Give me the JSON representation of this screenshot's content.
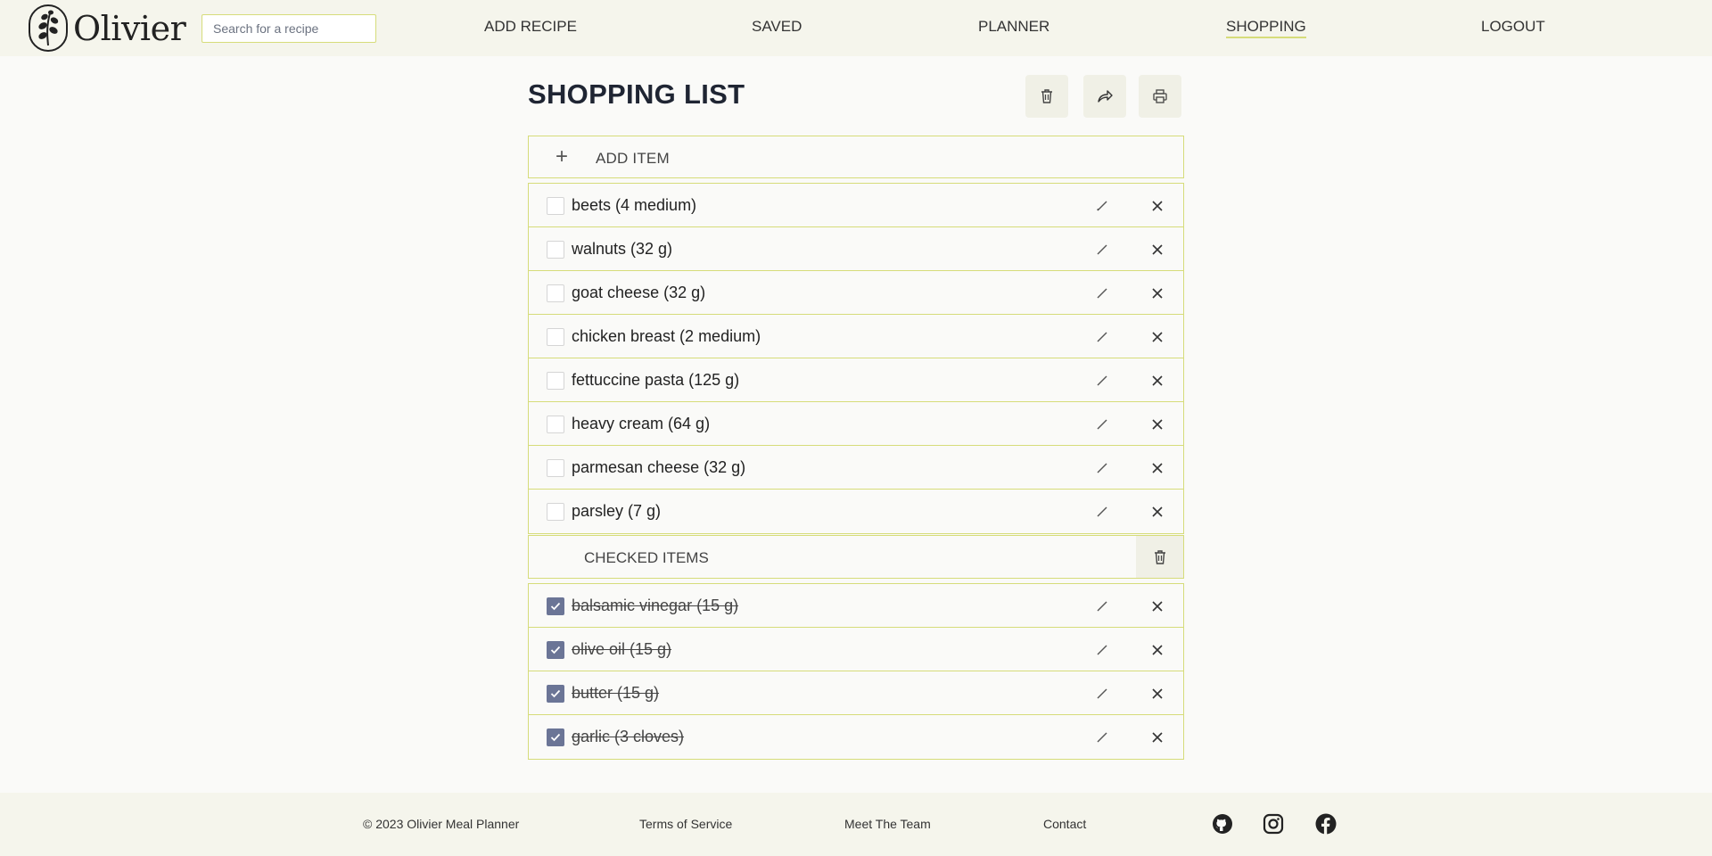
{
  "header": {
    "logo_text": "Olivier",
    "search_placeholder": "Search for a recipe",
    "nav": [
      {
        "label": "ADD RECIPE"
      },
      {
        "label": "SAVED"
      },
      {
        "label": "PLANNER"
      },
      {
        "label": "SHOPPING",
        "active": true
      },
      {
        "label": "LOGOUT"
      }
    ]
  },
  "page": {
    "title": "SHOPPING LIST",
    "toolbar": {
      "icons": [
        "trash-icon",
        "share-icon",
        "print-icon"
      ]
    },
    "add_item_label": "ADD ITEM",
    "items": [
      {
        "text": "beets (4 medium)",
        "checked": false
      },
      {
        "text": "walnuts (32 g)",
        "checked": false
      },
      {
        "text": "goat cheese (32 g)",
        "checked": false
      },
      {
        "text": "chicken breast (2 medium)",
        "checked": false
      },
      {
        "text": "fettuccine pasta (125 g)",
        "checked": false
      },
      {
        "text": "heavy cream (64 g)",
        "checked": false
      },
      {
        "text": "parmesan cheese (32 g)",
        "checked": false
      },
      {
        "text": "parsley (7 g)",
        "checked": false
      }
    ],
    "checked_section_label": "CHECKED ITEMS",
    "checked_items": [
      {
        "text": "balsamic vinegar (15 g)",
        "checked": true
      },
      {
        "text": "olive oil (15 g)",
        "checked": true
      },
      {
        "text": "butter (15 g)",
        "checked": true
      },
      {
        "text": "garlic (3 cloves)",
        "checked": true
      }
    ]
  },
  "footer": {
    "copyright": "© 2023 Olivier Meal Planner",
    "links": [
      "Terms of Service",
      "Meet The Team",
      "Contact"
    ],
    "social": [
      "github-icon",
      "instagram-icon",
      "facebook-icon"
    ]
  },
  "colors": {
    "accent": "#d6dc7a",
    "header_bg": "#f5f5ec",
    "checkbox_checked": "#6b7596",
    "title": "#1f2533"
  }
}
